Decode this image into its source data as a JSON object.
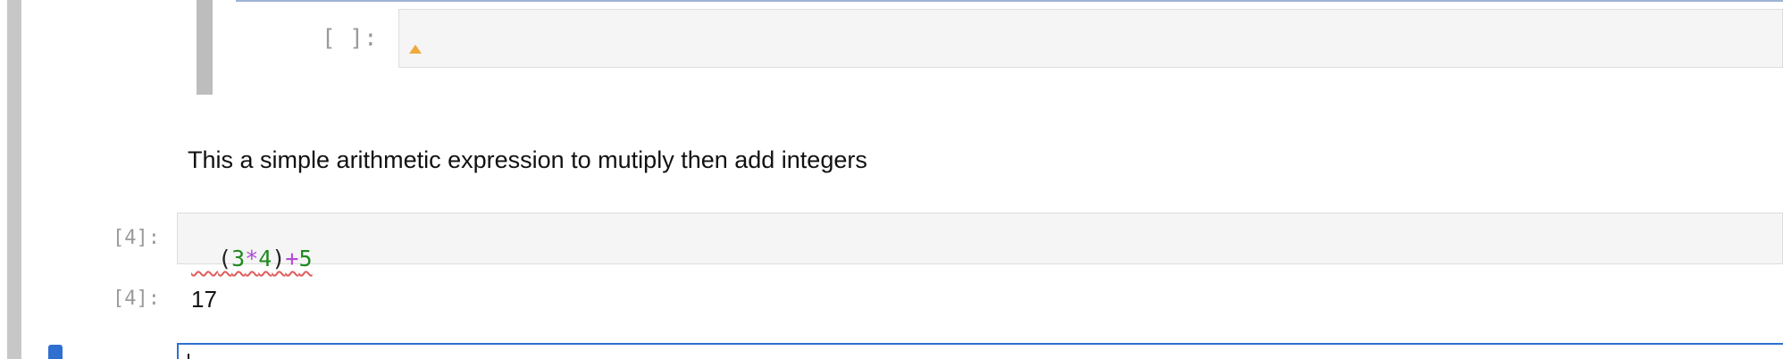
{
  "notebook": {
    "cells": {
      "nested_empty": {
        "prompt": "[ ]:"
      },
      "markdown": {
        "text": "This a simple arithmetic expression to mutiply then add integers"
      },
      "code_4": {
        "input_prompt": "[4]:",
        "code_tokens": [
          "(",
          "3",
          "*",
          "4",
          ")",
          "+",
          "5"
        ],
        "output_prompt": "[4]:",
        "output": "17"
      }
    }
  },
  "colors": {
    "active": "#2f6fd0",
    "string": "#1f8a1f",
    "operator": "#b24ad8",
    "warning": "#f0a93b"
  }
}
